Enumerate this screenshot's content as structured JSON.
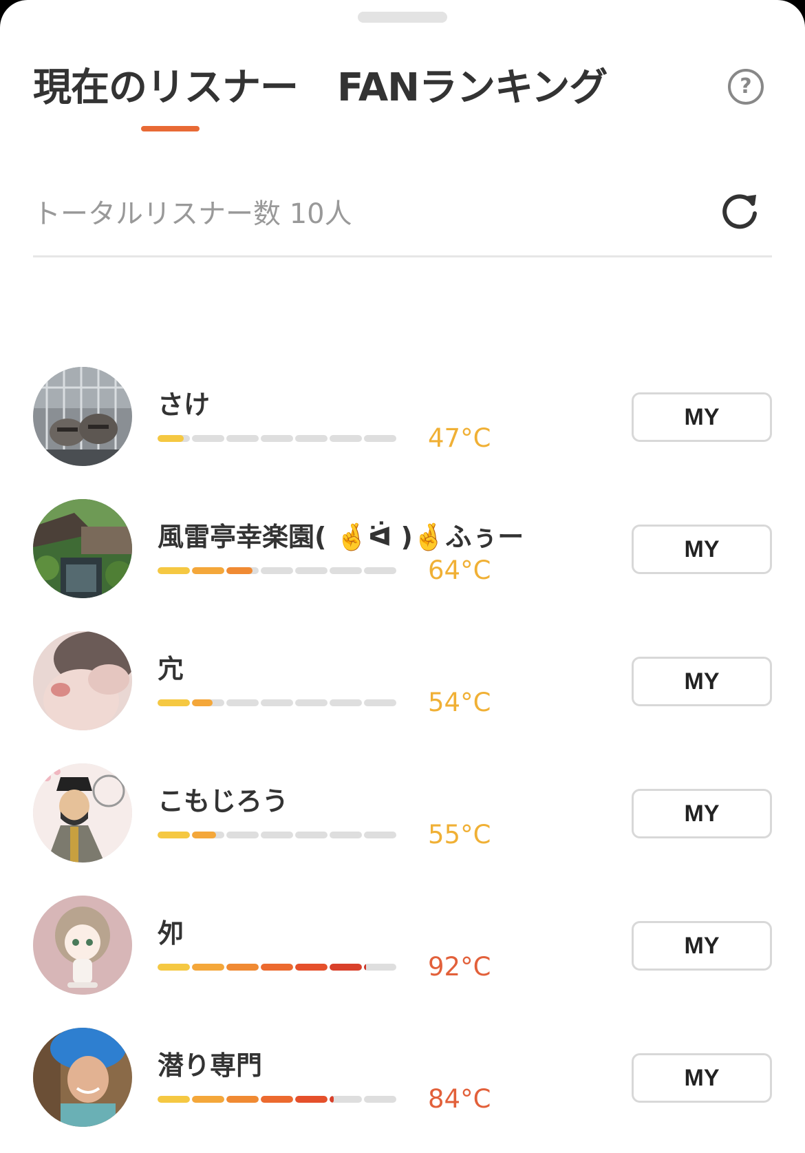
{
  "header": {
    "tabs": [
      {
        "label": "現在のリスナー",
        "active": true
      },
      {
        "label": "FANランキング",
        "active": false
      }
    ],
    "help_icon": "question-circle-icon",
    "help_glyph": "?"
  },
  "summary": {
    "total_label": "トータルリスナー数 10人",
    "refresh_icon": "refresh-icon"
  },
  "listeners": [
    {
      "name": "さけ",
      "temperature": 47,
      "temp_label": "47°C",
      "temp_color": "#f0b035",
      "my_label": "MY",
      "avatar": "raccoons-photo"
    },
    {
      "name": "風雷亭幸楽園( 🤞ᐛ )🤞ふぅー",
      "temperature": 64,
      "temp_label": "64°C",
      "temp_color": "#f0b035",
      "my_label": "MY",
      "avatar": "village-stream-photo"
    },
    {
      "name": "宂",
      "temperature": 54,
      "temp_label": "54°C",
      "temp_color": "#f0b035",
      "my_label": "MY",
      "avatar": "blurred-portrait-photo"
    },
    {
      "name": "こもじろう",
      "temperature": 55,
      "temp_label": "55°C",
      "temp_color": "#f0b035",
      "my_label": "MY",
      "avatar": "samurai-illustration"
    },
    {
      "name": "夘",
      "temperature": 92,
      "temp_label": "92°C",
      "temp_color": "#e2603a",
      "my_label": "MY",
      "avatar": "anime-character-illustration"
    },
    {
      "name": "潜り専門",
      "temperature": 84,
      "temp_label": "84°C",
      "temp_color": "#e2603a",
      "my_label": "MY",
      "avatar": "blue-hair-selfie-photo"
    }
  ],
  "colors": {
    "accent": "#e86a35",
    "segment_empty": "#dedede",
    "segment_scale": [
      "#f5c842",
      "#f4a73a",
      "#f08a33",
      "#ec6a2f",
      "#e5502b",
      "#d9402a",
      "#cc3526"
    ]
  }
}
